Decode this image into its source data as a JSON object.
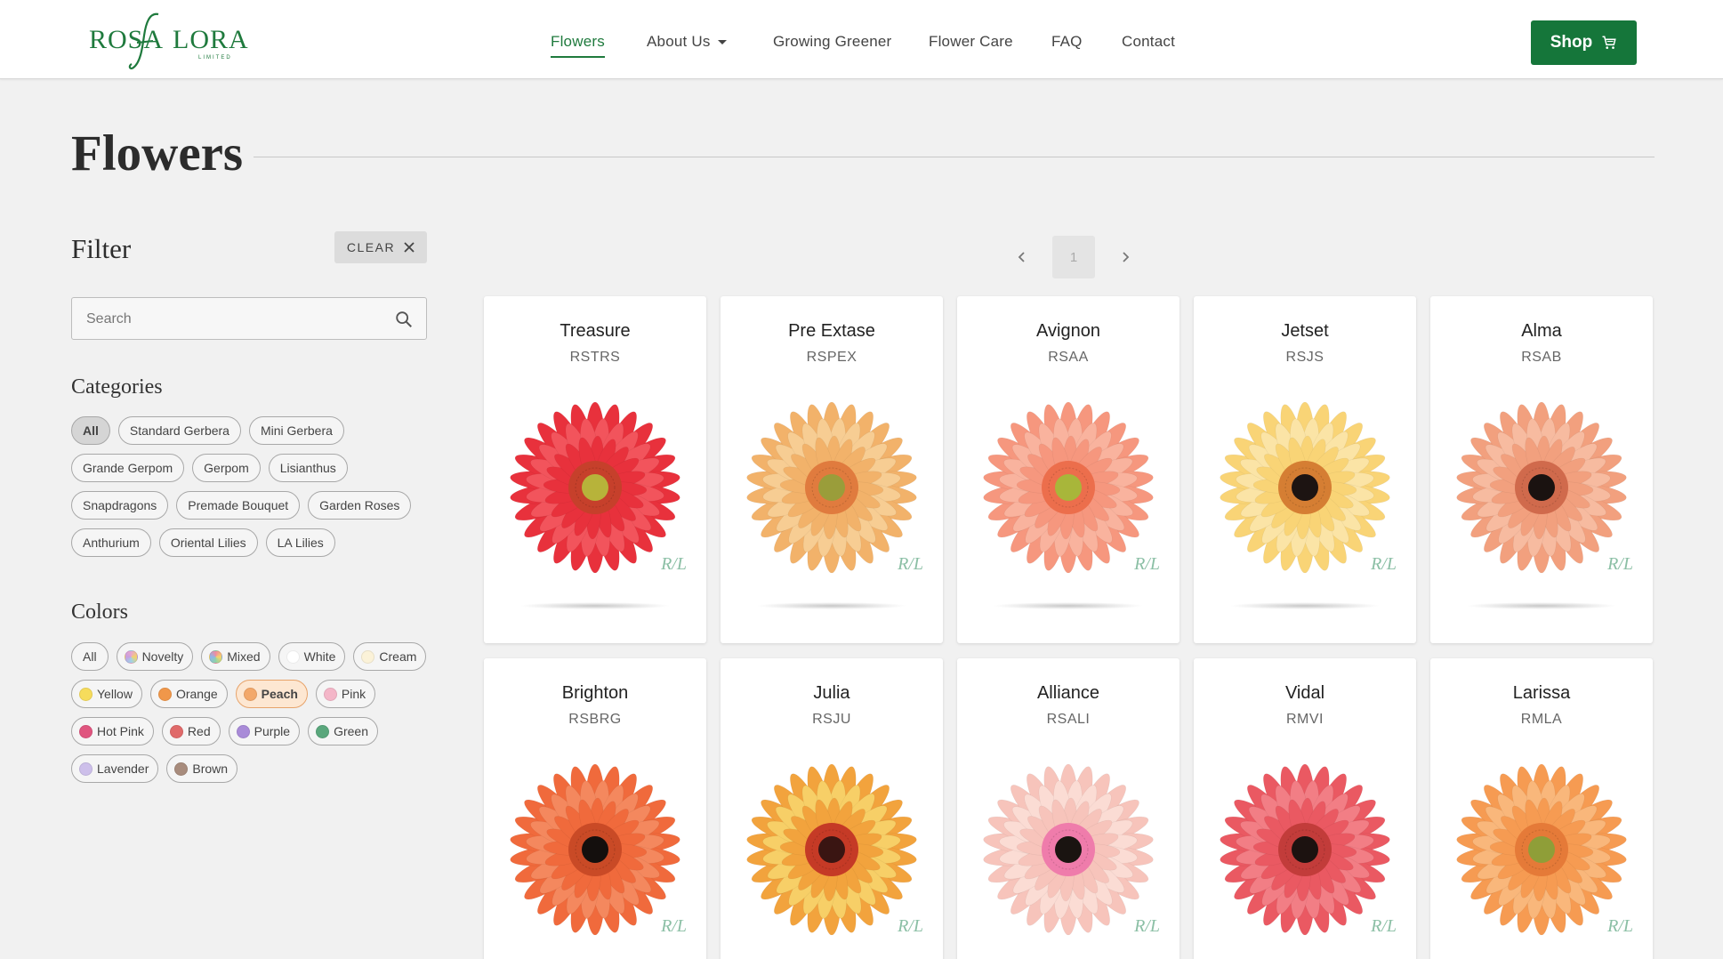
{
  "header": {
    "logo": {
      "left": "ROSA",
      "right": "LORA",
      "sub": "LIMITED"
    },
    "nav": [
      {
        "label": "Flowers",
        "active": true
      },
      {
        "label": "About Us",
        "active": false
      },
      {
        "label": "Growing Greener",
        "active": false
      },
      {
        "label": "Flower Care",
        "active": false
      },
      {
        "label": "FAQ",
        "active": false
      },
      {
        "label": "Contact",
        "active": false
      }
    ],
    "shop_label": "Shop"
  },
  "page": {
    "title": "Flowers"
  },
  "sidebar": {
    "filter_title": "Filter",
    "clear_label": "CLEAR",
    "search_placeholder": "Search",
    "categories_title": "Categories",
    "categories": [
      {
        "label": "All",
        "selected": true
      },
      {
        "label": "Standard Gerbera",
        "selected": false
      },
      {
        "label": "Mini Gerbera",
        "selected": false
      },
      {
        "label": "Grande Gerpom",
        "selected": false
      },
      {
        "label": "Gerpom",
        "selected": false
      },
      {
        "label": "Lisianthus",
        "selected": false
      },
      {
        "label": "Snapdragons",
        "selected": false
      },
      {
        "label": "Premade Bouquet",
        "selected": false
      },
      {
        "label": "Garden Roses",
        "selected": false
      },
      {
        "label": "Anthurium",
        "selected": false
      },
      {
        "label": "Oriental Lilies",
        "selected": false
      },
      {
        "label": "LA Lilies",
        "selected": false
      }
    ],
    "colors_title": "Colors",
    "colors": [
      {
        "label": "All",
        "swatch": null,
        "selected": false
      },
      {
        "label": "Novelty",
        "swatch": "conic-gradient(#e9a6cf, #f3d36b, #9fd2e8, #c8a0e0, #e9a6cf)",
        "selected": false
      },
      {
        "label": "Mixed",
        "swatch": "conic-gradient(#f08aa0, #f6d66a, #8fd3a8, #8fb6e8, #f08aa0)",
        "selected": false
      },
      {
        "label": "White",
        "swatch": "#ffffff",
        "selected": false
      },
      {
        "label": "Cream",
        "swatch": "#fbf2d8",
        "selected": false
      },
      {
        "label": "Yellow",
        "swatch": "#f6dc5c",
        "selected": false
      },
      {
        "label": "Orange",
        "swatch": "#f0974a",
        "selected": false
      },
      {
        "label": "Peach",
        "swatch": "#f3a86a",
        "selected": true
      },
      {
        "label": "Pink",
        "swatch": "#f4b6c8",
        "selected": false
      },
      {
        "label": "Hot Pink",
        "swatch": "#e0557f",
        "selected": false
      },
      {
        "label": "Red",
        "swatch": "#e06a6a",
        "selected": false
      },
      {
        "label": "Purple",
        "swatch": "#a98bd8",
        "selected": false
      },
      {
        "label": "Green",
        "swatch": "#5aa77c",
        "selected": false
      },
      {
        "label": "Lavender",
        "swatch": "#cdbfea",
        "selected": false
      },
      {
        "label": "Brown",
        "swatch": "#a88c7d",
        "selected": false
      }
    ]
  },
  "pagination": {
    "current": "1"
  },
  "products": [
    {
      "name": "Treasure",
      "code": "RSTRS",
      "petal": "#e8313c",
      "petal_light": "#f2545c",
      "center": "#b7b33a",
      "ring": "#c6402b"
    },
    {
      "name": "Pre Extase",
      "code": "RSPEX",
      "petal": "#f2b26a",
      "petal_light": "#f7cd93",
      "center": "#9a9d3a",
      "ring": "#e07b3e"
    },
    {
      "name": "Avignon",
      "code": "RSAA",
      "petal": "#f6977e",
      "petal_light": "#f9b39e",
      "center": "#a8b63a",
      "ring": "#ec6e4c"
    },
    {
      "name": "Jetset",
      "code": "RSJS",
      "petal": "#f9d476",
      "petal_light": "#fbe4a6",
      "center": "#1d1412",
      "ring": "#d57e33"
    },
    {
      "name": "Alma",
      "code": "RSAB",
      "petal": "#f2a07e",
      "petal_light": "#f7bba0",
      "center": "#1a1210",
      "ring": "#d06a4c"
    },
    {
      "name": "Brighton",
      "code": "RSBRG",
      "petal": "#f06a3c",
      "petal_light": "#f4885e",
      "center": "#140f0d",
      "ring": "#c94a26"
    },
    {
      "name": "Julia",
      "code": "RSJU",
      "petal": "#f2a33d",
      "petal_light": "#f7cf67",
      "center": "#3a1512",
      "ring": "#c53a26"
    },
    {
      "name": "Alliance",
      "code": "RSALI",
      "petal": "#f7c4bb",
      "petal_light": "#fbdcd4",
      "center": "#1a1411",
      "ring": "#ef7cab"
    },
    {
      "name": "Vidal",
      "code": "RMVI",
      "petal": "#ea5962",
      "petal_light": "#f27e85",
      "center": "#1c1210",
      "ring": "#c23c3a"
    },
    {
      "name": "Larissa",
      "code": "RMLA",
      "petal": "#f69b52",
      "petal_light": "#f9b77b",
      "center": "#8f9e38",
      "ring": "#e57a38"
    }
  ],
  "card_mark": "R/L"
}
